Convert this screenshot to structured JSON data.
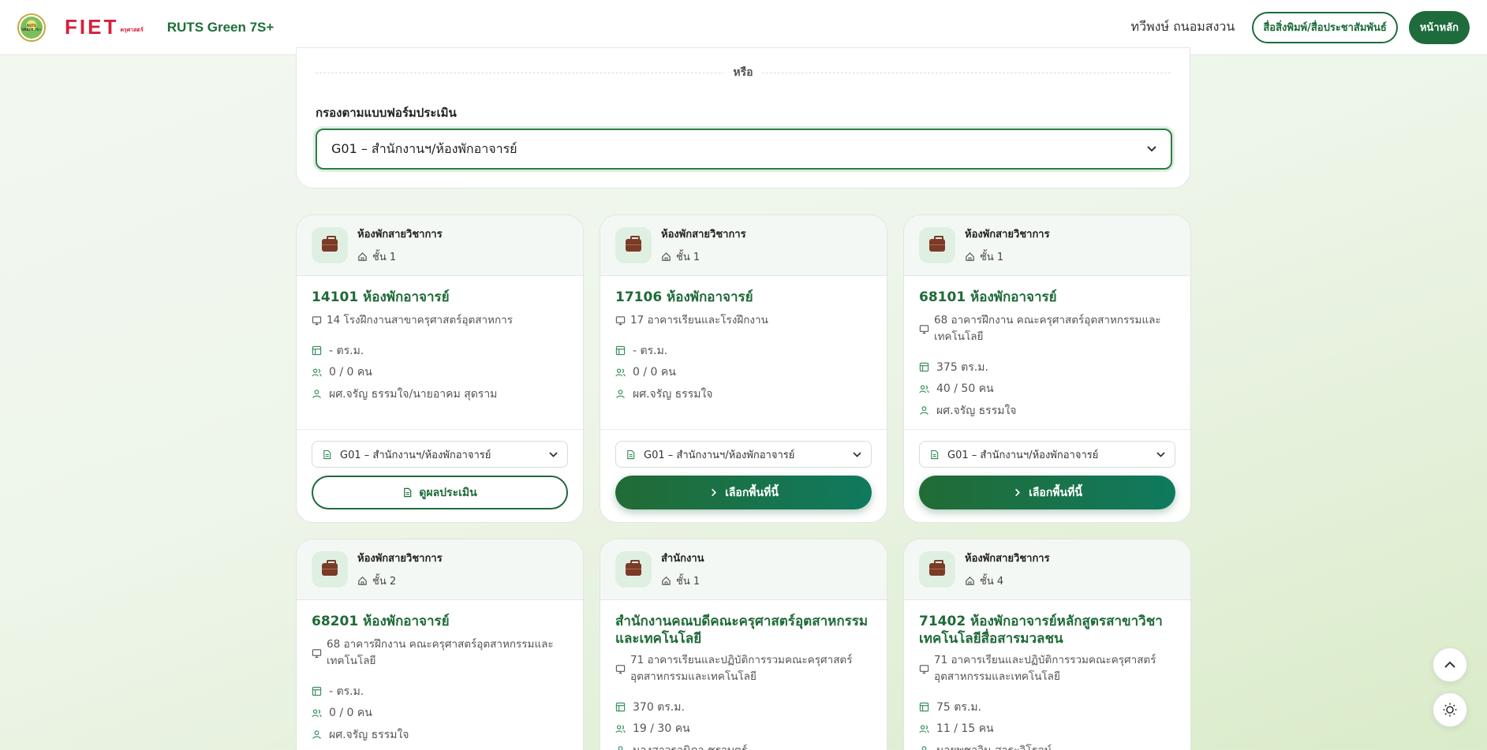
{
  "header": {
    "logo_ruts_text": "RUTS GREEN 7S+",
    "logo_fiet_text": "FIET",
    "logo_fiet_sub": "ครุศาสตร์",
    "app_title": "RUTS Green 7S+",
    "user_name": "ทวีพงษ์ ถนอมสงวน",
    "media_button": "สื่อสิ่งพิมพ์/สื่อประชาสัมพันธ์",
    "home_button": "หน้าหลัก"
  },
  "filter": {
    "or_text": "หรือ",
    "label": "กรองตามแบบฟอร์มประเมิน",
    "selected": "G01 – สำนักงานฯ/ห้องพักอาจารย์"
  },
  "cards": [
    {
      "category": "ห้องพักสายวิชาการ",
      "floor": "ชั้น 1",
      "title": "14101 ห้องพักอาจารย์",
      "location": "14 โรงฝึกงานสาขาครุศาสตร์อุตสาหการ",
      "area": "- ตร.ม.",
      "capacity": "0 / 0 คน",
      "owner": "ผศ.จรัญ ธรรมใจ/นายอาคม สุดราม",
      "form": "G01 – สำนักงานฯ/ห้องพักอาจารย์",
      "action": "ดูผลประเมิน"
    },
    {
      "category": "ห้องพักสายวิชาการ",
      "floor": "ชั้น 1",
      "title": "17106 ห้องพักอาจารย์",
      "location": "17 อาคารเรียนและโรงฝึกงาน",
      "area": "- ตร.ม.",
      "capacity": "0 / 0 คน",
      "owner": "ผศ.จรัญ ธรรมใจ",
      "form": "G01 – สำนักงานฯ/ห้องพักอาจารย์",
      "action": "เลือกพื้นที่นี้"
    },
    {
      "category": "ห้องพักสายวิชาการ",
      "floor": "ชั้น 1",
      "title": "68101 ห้องพักอาจารย์",
      "location": "68 อาคารฝึกงาน คณะครุศาสตร์อุตสาหกรรมและเทคโนโลยี",
      "area": "375 ตร.ม.",
      "capacity": "40 / 50 คน",
      "owner": "ผศ.จรัญ ธรรมใจ",
      "form": "G01 – สำนักงานฯ/ห้องพักอาจารย์",
      "action": "เลือกพื้นที่นี้"
    },
    {
      "category": "ห้องพักสายวิชาการ",
      "floor": "ชั้น 2",
      "title": "68201 ห้องพักอาจารย์",
      "location": "68 อาคารฝึกงาน คณะครุศาสตร์อุตสาหกรรมและเทคโนโลยี",
      "area": "- ตร.ม.",
      "capacity": "0 / 0 คน",
      "owner": "ผศ.จรัญ ธรรมใจ"
    },
    {
      "category": "สำนักงาน",
      "floor": "ชั้น 1",
      "title": "สำนักงานคณบดีคณะครุศาสตร์อุตสาหกรรมและเทคโนโลยี",
      "location": "71 อาคารเรียนและปฏิบัติการรวมคณะครุศาสตร์อุตสาหกรรมและเทคโนโลยี",
      "area": "370 ตร.ม.",
      "capacity": "19 / 30 คน",
      "owner": "นางสาวฐานิดา ชราบุตร์"
    },
    {
      "category": "ห้องพักสายวิชาการ",
      "floor": "ชั้น 4",
      "title": "71402 ห้องพักอาจารย์หลักสูตรสาขาวิชาเทคโนโลยีสื่อสารมวลชน",
      "location": "71 อาคารเรียนและปฏิบัติการรวมคณะครุศาสตร์อุตสาหกรรมและเทคโนโลยี",
      "area": "75 ตร.ม.",
      "capacity": "11 / 15 คน",
      "owner": "นายพุชาวิน สาระวิโรจน์"
    }
  ],
  "floating": {
    "scroll_top_icon": "chevron-up-icon",
    "theme_icon": "sun-icon"
  },
  "colors": {
    "brand_green": "#1e6b3c",
    "title_green": "#1f6a38",
    "fiet_red": "#d81e3a"
  }
}
